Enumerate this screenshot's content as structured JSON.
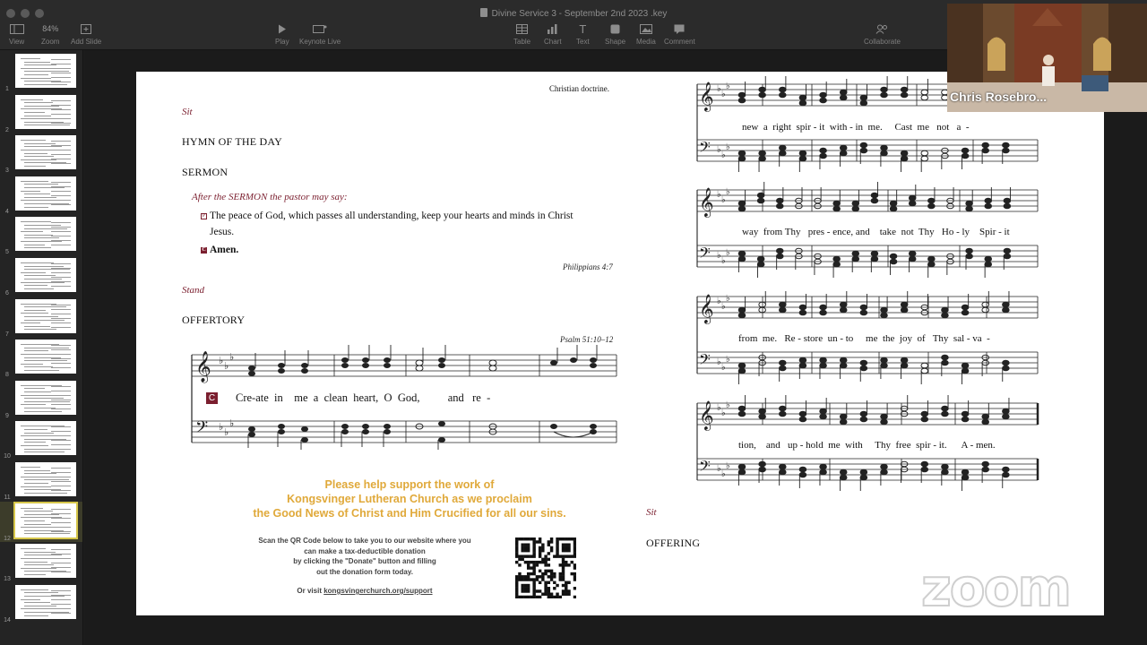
{
  "window": {
    "title": "Divine Service 3 - September 2nd 2023 .key",
    "zoom_level": "84%"
  },
  "toolbar": {
    "left": [
      {
        "label": "View",
        "icon": "view-icon"
      },
      {
        "label": "Zoom",
        "icon": "zoom-level"
      },
      {
        "label": "Add Slide",
        "icon": "plus-icon"
      }
    ],
    "center": [
      {
        "label": "Play",
        "icon": "play-icon"
      },
      {
        "label": "Keynote Live",
        "icon": "keynote-live-icon"
      }
    ],
    "insert": [
      {
        "label": "Table",
        "icon": "table-icon"
      },
      {
        "label": "Chart",
        "icon": "chart-icon"
      },
      {
        "label": "Text",
        "icon": "text-icon"
      },
      {
        "label": "Shape",
        "icon": "shape-icon"
      },
      {
        "label": "Media",
        "icon": "media-icon"
      },
      {
        "label": "Comment",
        "icon": "comment-icon"
      }
    ],
    "right": [
      {
        "label": "Collaborate",
        "icon": "collaborate-icon"
      }
    ]
  },
  "sidebar": {
    "slides": [
      "1",
      "2",
      "3",
      "4",
      "5",
      "6",
      "7",
      "8",
      "9",
      "10",
      "11",
      "12",
      "13",
      "14"
    ],
    "selected": "12"
  },
  "slide": {
    "left": {
      "top_text": "Christian doctrine.",
      "sit_1": "Sit",
      "hymn_of_the_day": "HYMN OF THE DAY",
      "sermon": "SERMON",
      "after_sermon_1": "After the ",
      "after_sermon_sc": "SERMON",
      "after_sermon_2": " the pastor may say:",
      "p_mark": "P",
      "peace_line_1": "The peace of God, which passes all understanding, keep your hearts and minds in Christ",
      "peace_line_2": "Jesus.",
      "c_mark": "C",
      "amen": "Amen.",
      "philippians": "Philippians 4:7",
      "stand": "Stand",
      "offertory": "OFFERTORY",
      "psalm_ref": "Psalm 51:10–12",
      "lyric": "Cre-ate  in    me  a  clean  heart,  O  God,          and   re  -"
    },
    "right": {
      "lyric_1": "new  a  right  spir - it  with - in  me.     Cast  me   not   a  -",
      "lyric_2": "way  from Thy   pres - ence, and    take  not  Thy   Ho - ly    Spir - it",
      "lyric_3": "from  me.   Re - store  un - to     me  the  joy  of   Thy  sal - va  -",
      "lyric_4": "tion,    and   up - hold  me  with     Thy  free  spir - it.      A - men.",
      "sit_2": "Sit",
      "offering": "OFFERING"
    },
    "promo": {
      "line_1": "Please help support the work of",
      "line_2": "Kongsvinger Lutheran Church as we proclaim",
      "line_3": "the Good News of Christ and Him Crucified for all our sins.",
      "scan_1": "Scan the QR Code below to take you to our website where you",
      "scan_2": "can make a tax-deductible donation",
      "scan_3": "by clicking the \"Donate\" button and filling",
      "scan_4": "out the donation form today.",
      "visit_prefix": "Or visit ",
      "visit_link": "kongsvingerchurch.org/support"
    }
  },
  "video": {
    "participant": "Chris Rosebro...",
    "watermark": "zoom"
  },
  "colors": {
    "rubric": "#7b1f2f",
    "promo": "#e0a93a",
    "toolbar": "#2b2b2b",
    "selected_slide": "#d6c64a"
  }
}
